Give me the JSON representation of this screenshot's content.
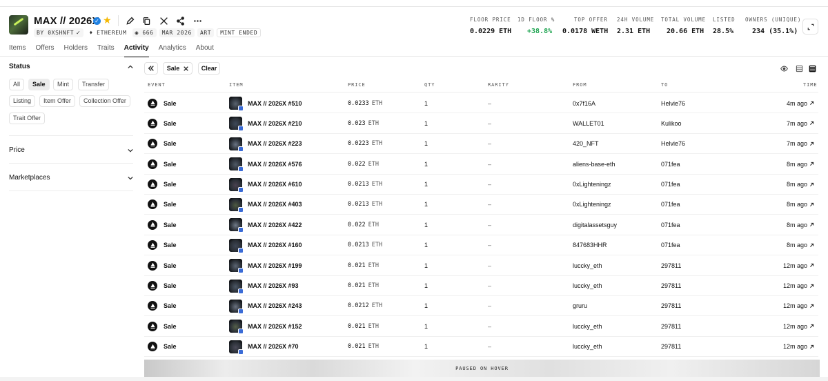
{
  "collection": {
    "title": "MAX // 2026X",
    "creator": "BY 0XSHNFT",
    "chain": "ETHEREUM",
    "supply": "666",
    "date": "MAR 2026",
    "category": "ART",
    "mint_status": "MINT ENDED"
  },
  "stats": [
    {
      "label": "FLOOR PRICE",
      "value": "0.0229 ETH"
    },
    {
      "label": "1D FLOOR %",
      "value": "+38.8%"
    },
    {
      "label": "TOP OFFER",
      "value": "0.0178 WETH"
    },
    {
      "label": "24H VOLUME",
      "value": "2.31 ETH"
    },
    {
      "label": "TOTAL VOLUME",
      "value": "20.66 ETH"
    },
    {
      "label": "LISTED",
      "value": "28.5%"
    },
    {
      "label": "OWNERS (UNIQUE)",
      "value": "234 (35.1%)"
    }
  ],
  "colors": {
    "positive": "#1ea451",
    "verified": "#2081e2",
    "star": "#f5b800"
  },
  "tabs": [
    {
      "label": "Items"
    },
    {
      "label": "Offers"
    },
    {
      "label": "Holders"
    },
    {
      "label": "Traits"
    },
    {
      "label": "Activity",
      "active": true
    },
    {
      "label": "Analytics"
    },
    {
      "label": "About"
    }
  ],
  "sidebar": {
    "status_label": "Status",
    "status_chips": [
      "All",
      "Sale",
      "Mint",
      "Transfer",
      "Listing",
      "Item Offer",
      "Collection Offer",
      "Trait Offer"
    ],
    "active_chip": "Sale",
    "price_label": "Price",
    "marketplaces_label": "Marketplaces"
  },
  "filters": {
    "active_filter": "Sale",
    "clear_label": "Clear"
  },
  "table": {
    "headers": [
      "EVENT",
      "ITEM",
      "PRICE",
      "QTY",
      "RARITY",
      "FROM",
      "TO",
      "TIME"
    ],
    "rows": [
      {
        "event": "Sale",
        "item": "MAX // 2026X #510",
        "price": "0.0233",
        "unit": "ETH",
        "qty": "1",
        "rarity": "–",
        "from": "0x7f16A",
        "to": "Helvie76",
        "time": "4m ago"
      },
      {
        "event": "Sale",
        "item": "MAX // 2026X #210",
        "price": "0.023",
        "unit": "ETH",
        "qty": "1",
        "rarity": "–",
        "from": "WALLET01",
        "to": "Kulikoo",
        "time": "7m ago"
      },
      {
        "event": "Sale",
        "item": "MAX // 2026X #223",
        "price": "0.0223",
        "unit": "ETH",
        "qty": "1",
        "rarity": "–",
        "from": "420_NFT",
        "to": "Helvie76",
        "time": "7m ago"
      },
      {
        "event": "Sale",
        "item": "MAX // 2026X #576",
        "price": "0.022",
        "unit": "ETH",
        "qty": "1",
        "rarity": "–",
        "from": "aliens-base-eth",
        "to": "071fea",
        "time": "8m ago"
      },
      {
        "event": "Sale",
        "item": "MAX // 2026X #610",
        "price": "0.0213",
        "unit": "ETH",
        "qty": "1",
        "rarity": "–",
        "from": "0xLighteningz",
        "to": "071fea",
        "time": "8m ago"
      },
      {
        "event": "Sale",
        "item": "MAX // 2026X #403",
        "price": "0.0213",
        "unit": "ETH",
        "qty": "1",
        "rarity": "–",
        "from": "0xLighteningz",
        "to": "071fea",
        "time": "8m ago"
      },
      {
        "event": "Sale",
        "item": "MAX // 2026X #422",
        "price": "0.022",
        "unit": "ETH",
        "qty": "1",
        "rarity": "–",
        "from": "digitalassetsguy",
        "to": "071fea",
        "time": "8m ago"
      },
      {
        "event": "Sale",
        "item": "MAX // 2026X #160",
        "price": "0.0213",
        "unit": "ETH",
        "qty": "1",
        "rarity": "–",
        "from": "847683HHR",
        "to": "071fea",
        "time": "8m ago"
      },
      {
        "event": "Sale",
        "item": "MAX // 2026X #199",
        "price": "0.021",
        "unit": "ETH",
        "qty": "1",
        "rarity": "–",
        "from": "luccky_eth",
        "to": "297811",
        "time": "12m ago"
      },
      {
        "event": "Sale",
        "item": "MAX // 2026X #93",
        "price": "0.021",
        "unit": "ETH",
        "qty": "1",
        "rarity": "–",
        "from": "luccky_eth",
        "to": "297811",
        "time": "12m ago"
      },
      {
        "event": "Sale",
        "item": "MAX // 2026X #243",
        "price": "0.0212",
        "unit": "ETH",
        "qty": "1",
        "rarity": "–",
        "from": "gruru",
        "to": "297811",
        "time": "12m ago"
      },
      {
        "event": "Sale",
        "item": "MAX // 2026X #152",
        "price": "0.021",
        "unit": "ETH",
        "qty": "1",
        "rarity": "–",
        "from": "luccky_eth",
        "to": "297811",
        "time": "12m ago"
      },
      {
        "event": "Sale",
        "item": "MAX // 2026X #70",
        "price": "0.021",
        "unit": "ETH",
        "qty": "1",
        "rarity": "–",
        "from": "luccky_eth",
        "to": "297811",
        "time": "12m ago"
      }
    ]
  },
  "paused_label": "PAUSED ON HOVER"
}
